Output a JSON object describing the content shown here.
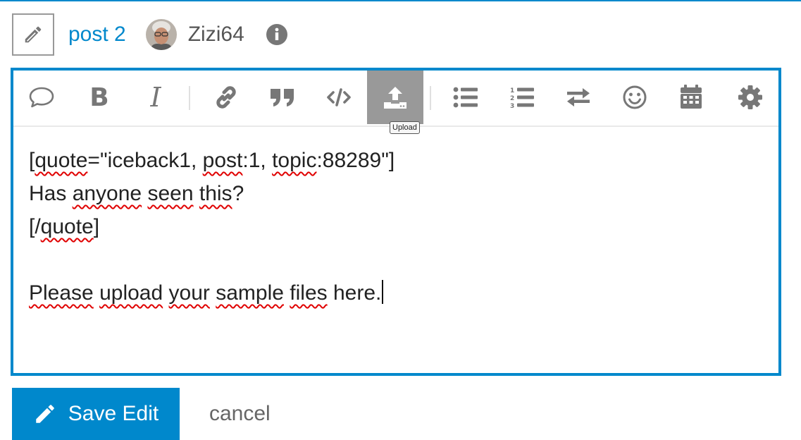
{
  "header": {
    "post_link": "post 2",
    "username": "Zizi64"
  },
  "toolbar": {
    "buttons": [
      {
        "icon": "speech-bubble-icon"
      },
      {
        "icon": "bold-icon",
        "glyph": "B"
      },
      {
        "icon": "italic-icon",
        "glyph": "I"
      },
      {
        "icon": "link-icon"
      },
      {
        "icon": "quote-icon"
      },
      {
        "icon": "code-icon",
        "glyph": "</>"
      },
      {
        "icon": "upload-icon"
      },
      {
        "icon": "bullet-list-icon"
      },
      {
        "icon": "numbered-list-icon"
      },
      {
        "icon": "swap-arrows-icon"
      },
      {
        "icon": "smiley-icon"
      },
      {
        "icon": "calendar-icon"
      },
      {
        "icon": "gear-icon"
      }
    ],
    "tooltip": "Upload"
  },
  "editor": {
    "lines": [
      "[quote=\"iceback1, post:1, topic:88289\"]",
      "Has anyone seen this?",
      "[/quote]",
      "",
      "Please upload your sample files here."
    ]
  },
  "footer": {
    "save_label": "Save Edit",
    "cancel_label": "cancel"
  },
  "colors": {
    "accent": "#0088cc",
    "active_button": "#999999",
    "icon": "#777777",
    "spell_error": "#e00000"
  }
}
